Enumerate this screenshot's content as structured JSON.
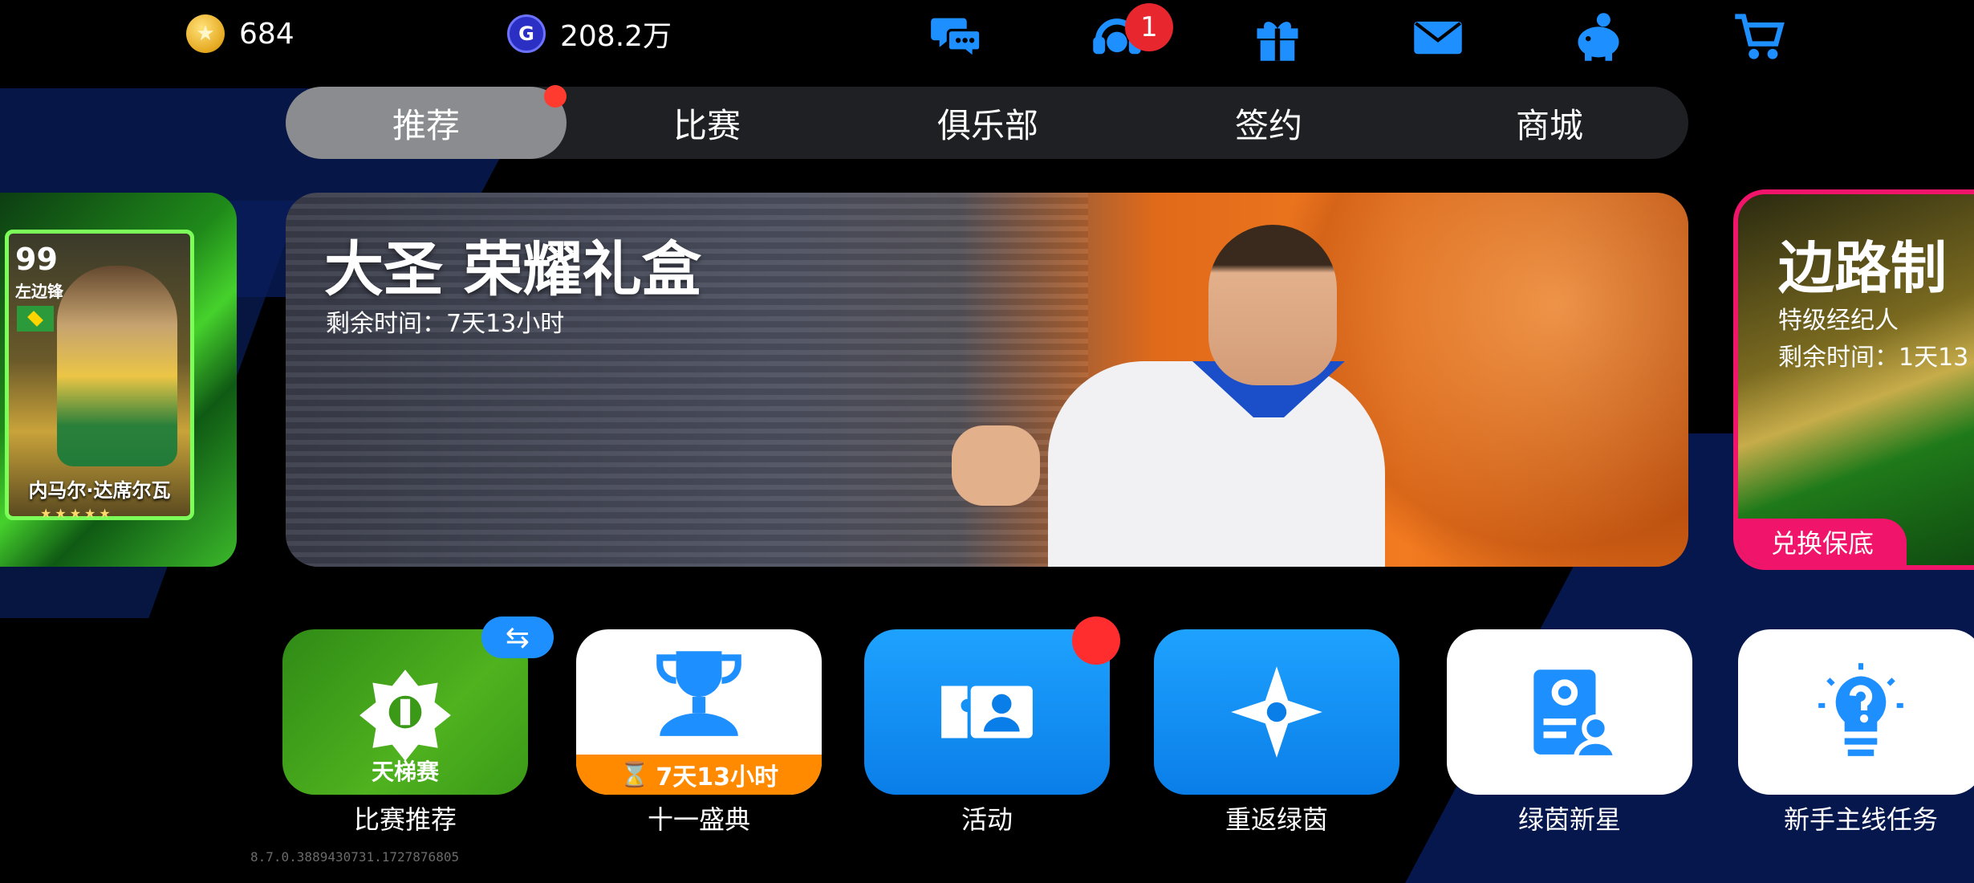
{
  "currency": {
    "coins": "684",
    "gp": "208.2万",
    "gp_symbol": "G",
    "coin_symbol": "★"
  },
  "top_icons": [
    {
      "name": "chat-icon"
    },
    {
      "name": "support-icon",
      "badge": "1"
    },
    {
      "name": "gift-icon"
    },
    {
      "name": "mail-icon"
    },
    {
      "name": "piggy-bank-icon"
    },
    {
      "name": "cart-icon"
    }
  ],
  "tabs": [
    {
      "label": "推荐",
      "active": true,
      "dot": true
    },
    {
      "label": "比赛"
    },
    {
      "label": "俱乐部"
    },
    {
      "label": "签约"
    },
    {
      "label": "商城"
    }
  ],
  "carousel": {
    "left_card": {
      "rating": "99",
      "position": "左边锋",
      "player_name": "内马尔·达席尔瓦",
      "stars": "★★★★★"
    },
    "main": {
      "title": "大圣 荣耀礼盒",
      "subtitle": "剩余时间：7天13小时"
    },
    "right_card": {
      "title": "边路制",
      "line1": "特级经纪人",
      "line2": "剩余时间：1天13",
      "tag": "兑换保底"
    }
  },
  "tiles": [
    {
      "label": "比赛推荐",
      "sub": "天梯赛",
      "badge": "⇆"
    },
    {
      "label": "十一盛典",
      "strip": "7天13小时",
      "strip_icon": "⌛"
    },
    {
      "label": "活动"
    },
    {
      "label": "重返绿茵"
    },
    {
      "label": "绿茵新星"
    },
    {
      "label": "新手主线任务"
    }
  ],
  "version": "8.7.0.3889430731.1727876805",
  "colors": {
    "badge_red": "#e8262d",
    "tab_active": "#8a8c90",
    "tile_blue": "#1ea2ff",
    "tile_green": "#4fb21e",
    "accent_orange": "#ff8a00",
    "pink": "#f0146a"
  }
}
